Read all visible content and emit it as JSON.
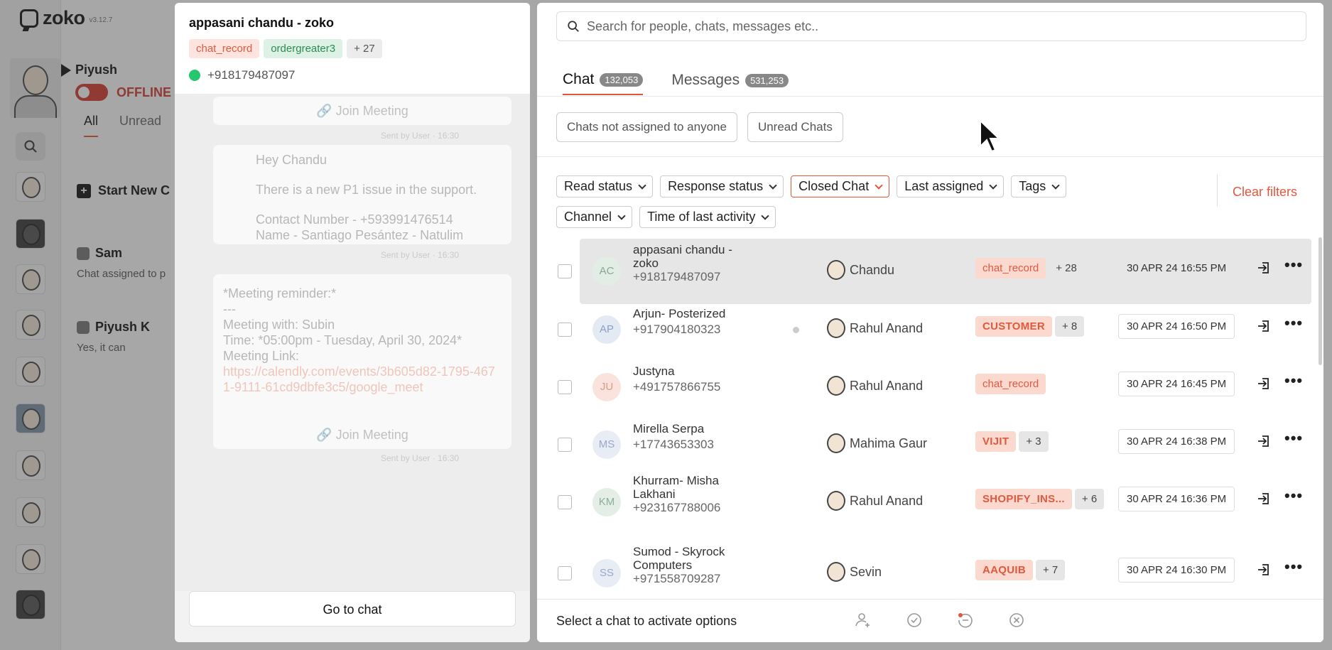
{
  "app": {
    "brand": "zoko",
    "version": "v3.12.7",
    "user_name": "Piyush",
    "status": "OFFLINE",
    "list_tabs": [
      "All",
      "Unread"
    ],
    "start_new": "Start New C",
    "bg_chats": [
      {
        "name": "Sam",
        "preview": "Chat assigned to p"
      },
      {
        "name": "Piyush K",
        "preview": "Yes, it can"
      }
    ]
  },
  "preview": {
    "title": "appasani chandu - zoko",
    "tags": [
      "chat_record",
      "ordergreater3",
      "+ 27"
    ],
    "phone": "+918179487097",
    "join_meeting": "Join Meeting",
    "sent_by": "Sent by User · 16:30",
    "msg1_lines": [
      "Hey Chandu",
      "There is a new P1 issue in the support.",
      "Contact Number - +593991476514",
      "Name - Santiago Pesántez - Natulim"
    ],
    "msg2_lines": [
      "*Meeting reminder:*",
      "---",
      "Meeting with: Subin",
      "Time: *05:00pm - Tuesday, April 30, 2024*",
      "Meeting Link:"
    ],
    "msg2_link": "https://calendly.com/events/3b605d82-1795-4671-9111-61cd9dbfe3c5/google_meet",
    "go_to_chat": "Go to chat"
  },
  "panel": {
    "search_placeholder": "Search for people, chats, messages etc..",
    "tabs": [
      {
        "label": "Chat",
        "count": "132,053"
      },
      {
        "label": "Messages",
        "count": "531,253"
      }
    ],
    "quick_filters": [
      "Chats not assigned to anyone",
      "Unread Chats"
    ],
    "filters": [
      "Read status",
      "Response status",
      "Closed Chat",
      "Last assigned",
      "Tags",
      "Channel",
      "Time of last activity"
    ],
    "active_filter": "Closed Chat",
    "clear_filters": "Clear filters",
    "rows": [
      {
        "initials": "AC",
        "name": "appasani chandu - zoko",
        "phone": "+918179487097",
        "agent": "Chandu",
        "tag": "chat_record",
        "more": "+ 28",
        "date": "30 APR 24 16:55 PM"
      },
      {
        "initials": "AP",
        "name": "Arjun- Posterized",
        "phone": "+917904180323",
        "agent": "Rahul Anand",
        "tag": "CUSTOMER",
        "more": "+ 8",
        "date": "30 APR 24 16:50 PM"
      },
      {
        "initials": "JU",
        "name": "Justyna",
        "phone": "+491757866755",
        "agent": "Rahul Anand",
        "tag": "chat_record",
        "more": "",
        "date": "30 APR 24 16:45 PM"
      },
      {
        "initials": "MS",
        "name": "Mirella Serpa",
        "phone": "+17743653303",
        "agent": "Mahima Gaur",
        "tag": "VIJIT",
        "more": "+ 3",
        "date": "30 APR 24 16:38 PM"
      },
      {
        "initials": "KM",
        "name": "Khurram- Misha Lakhani",
        "phone": "+923167788006",
        "agent": "Rahul Anand",
        "tag": "SHOPIFY_INS...",
        "more": "+ 6",
        "date": "30 APR 24 16:36 PM"
      },
      {
        "initials": "SS",
        "name": "Sumod - Skyrock Computers",
        "phone": "+971558709287",
        "agent": "Sevin",
        "tag": "AAQUIB",
        "more": "+ 7",
        "date": "30 APR 24 16:30 PM"
      }
    ],
    "bottom_text": "Select a chat to activate options"
  }
}
